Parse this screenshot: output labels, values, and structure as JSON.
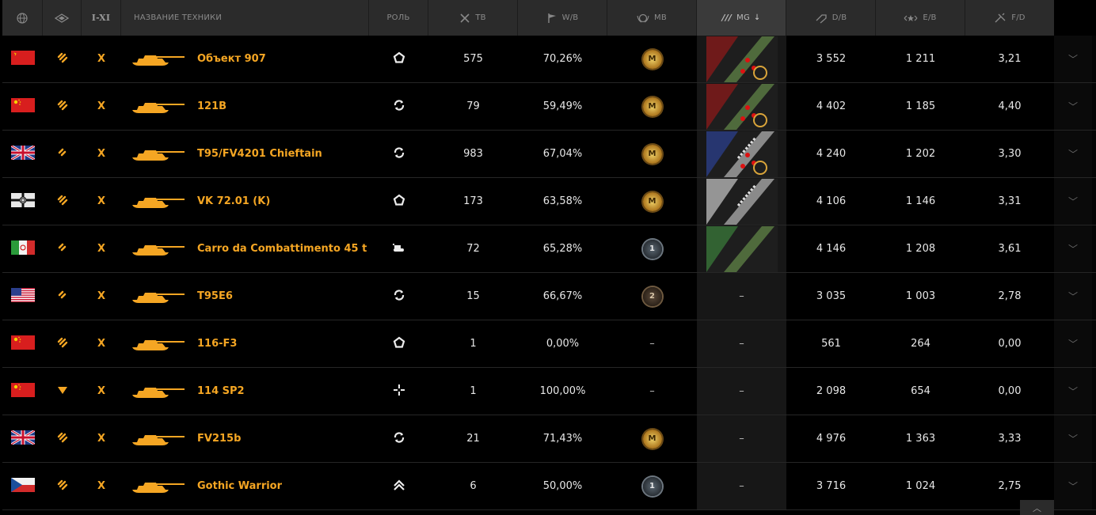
{
  "header": {
    "nation_icon": "globe-icon",
    "type_icon": "vehicle-type-icon",
    "tier_label": "I-XI",
    "name_label": "НАЗВАНИЕ ТЕХНИКИ",
    "role_label": "РОЛЬ",
    "battles_label": "ТВ",
    "winrate_label": "W/B",
    "mastery_label": "MB",
    "mg_label": "MG",
    "damage_label": "D/B",
    "exp_label": "E/B",
    "frags_label": "F/D"
  },
  "colors": {
    "accent": "#f5a623",
    "header_bg": "#2b2b2b",
    "row_bg": "#000000",
    "sorted_col_bg": "#171717"
  },
  "rows": [
    {
      "nation": "ussr",
      "flag_icon": "ussr-flag-icon",
      "type_icon": "heavy-tank-icon",
      "tier": "X",
      "name": "Объект 907",
      "role_icon": "pentagon-role-icon",
      "battles": "575",
      "winrate": "70,26%",
      "mastery": "M",
      "mastery_kind": "gold",
      "mg": "ussr-3-marks",
      "damage": "3 552",
      "exp": "1 211",
      "frags": "3,21"
    },
    {
      "nation": "china",
      "flag_icon": "china-flag-icon",
      "type_icon": "heavy-tank-icon",
      "tier": "X",
      "name": "121B",
      "role_icon": "circle-arrows-role-icon",
      "battles": "79",
      "winrate": "59,49%",
      "mastery": "M",
      "mastery_kind": "gold",
      "mg": "china-3-marks",
      "damage": "4 402",
      "exp": "1 185",
      "frags": "4,40"
    },
    {
      "nation": "uk",
      "flag_icon": "uk-flag-icon",
      "type_icon": "medium-tank-icon",
      "tier": "X",
      "name": "T95/FV4201 Chieftain",
      "role_icon": "circle-arrows-role-icon",
      "battles": "983",
      "winrate": "67,04%",
      "mastery": "M",
      "mastery_kind": "gold",
      "mg": "uk-3-marks",
      "damage": "4 240",
      "exp": "1 202",
      "frags": "3,30"
    },
    {
      "nation": "germany",
      "flag_icon": "germany-flag-icon",
      "type_icon": "heavy-tank-icon",
      "tier": "X",
      "name": "VK 72.01 (K)",
      "role_icon": "pentagon-role-icon",
      "battles": "173",
      "winrate": "63,58%",
      "mastery": "M",
      "mastery_kind": "gold",
      "mg": "germany-2-marks",
      "damage": "4 106",
      "exp": "1 146",
      "frags": "3,31"
    },
    {
      "nation": "italy",
      "flag_icon": "italy-flag-icon",
      "type_icon": "medium-tank-icon",
      "tier": "X",
      "name": "Carro da Combattimento 45 t",
      "role_icon": "tank-role-icon",
      "battles": "72",
      "winrate": "65,28%",
      "mastery": "1",
      "mastery_kind": "silver",
      "mg": "italy-1-mark",
      "damage": "4 146",
      "exp": "1 208",
      "frags": "3,61"
    },
    {
      "nation": "usa",
      "flag_icon": "usa-flag-icon",
      "type_icon": "medium-tank-icon",
      "tier": "X",
      "name": "T95E6",
      "role_icon": "circle-arrows-role-icon",
      "battles": "15",
      "winrate": "66,67%",
      "mastery": "2",
      "mastery_kind": "bronze",
      "mg": "–",
      "damage": "3 035",
      "exp": "1 003",
      "frags": "2,78"
    },
    {
      "nation": "china",
      "flag_icon": "china-flag-icon",
      "type_icon": "heavy-tank-icon",
      "tier": "X",
      "name": "116-F3",
      "role_icon": "pentagon-role-icon",
      "battles": "1",
      "winrate": "0,00%",
      "mastery": "–",
      "mastery_kind": "none",
      "mg": "–",
      "damage": "561",
      "exp": "264",
      "frags": "0,00"
    },
    {
      "nation": "china",
      "flag_icon": "china-flag-icon",
      "type_icon": "spg-icon",
      "tier": "X",
      "name": "114 SP2",
      "role_icon": "crosshair-role-icon",
      "battles": "1",
      "winrate": "100,00%",
      "mastery": "–",
      "mastery_kind": "none",
      "mg": "–",
      "damage": "2 098",
      "exp": "654",
      "frags": "0,00"
    },
    {
      "nation": "uk",
      "flag_icon": "uk-flag-icon",
      "type_icon": "heavy-tank-icon",
      "tier": "X",
      "name": "FV215b",
      "role_icon": "circle-arrows-role-icon",
      "battles": "21",
      "winrate": "71,43%",
      "mastery": "M",
      "mastery_kind": "gold",
      "mg": "–",
      "damage": "4 976",
      "exp": "1 363",
      "frags": "3,33"
    },
    {
      "nation": "czech",
      "flag_icon": "czech-flag-icon",
      "type_icon": "heavy-tank-icon",
      "tier": "X",
      "name": "Gothic Warrior",
      "role_icon": "chevron-up-role-icon",
      "battles": "6",
      "winrate": "50,00%",
      "mastery": "1",
      "mastery_kind": "silver",
      "mg": "–",
      "damage": "3 716",
      "exp": "1 024",
      "frags": "2,75"
    }
  ]
}
